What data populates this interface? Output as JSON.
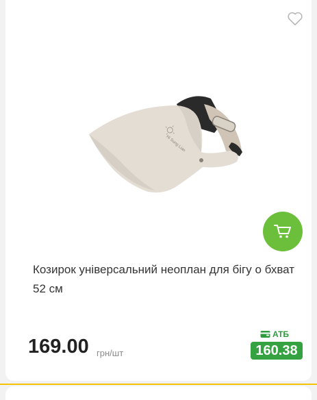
{
  "product": {
    "title": "Козирок універсальний неоплан для бігу о бхват 52 см",
    "price": "169.00",
    "unit": "грн/шт",
    "image_logo_text": "Hi Sung Lian",
    "wishlist_icon": "heart-outline-icon",
    "cart_icon": "cart-icon"
  },
  "atb": {
    "label": "АТБ",
    "price": "160.38",
    "icon": "wallet-card-icon"
  },
  "colors": {
    "accent_green": "#6cbf3a",
    "atb_green": "#35a242",
    "highlight_yellow": "#f5c400"
  }
}
